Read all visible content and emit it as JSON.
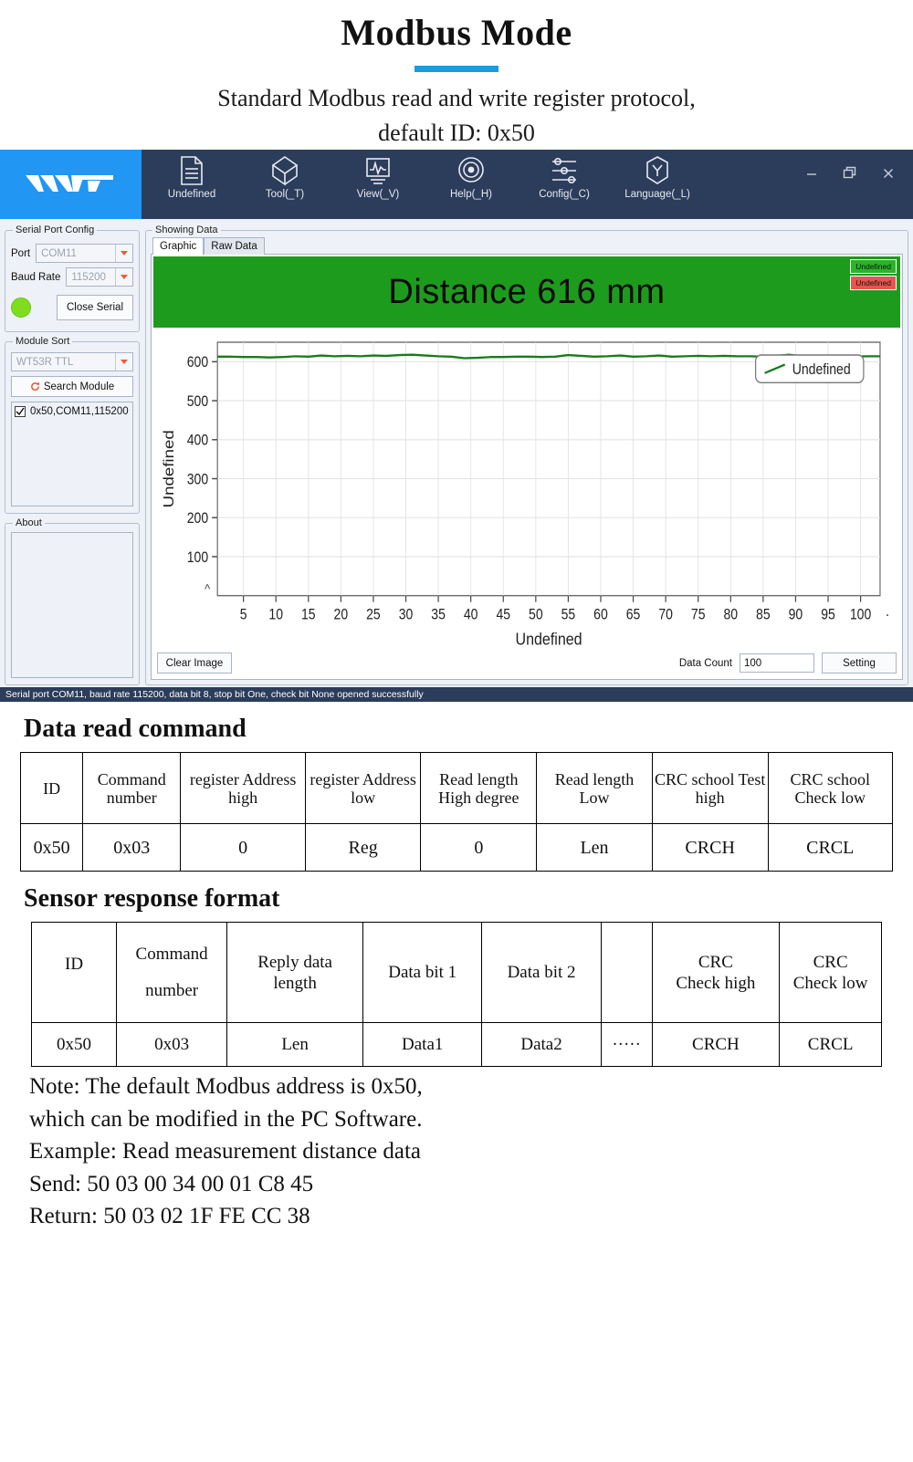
{
  "hero": {
    "title": "Modbus Mode",
    "rule_color": "#1e9ae0",
    "subtitle_line1": "Standard Modbus read and write register protocol,",
    "subtitle_line2": "default ID: 0x50"
  },
  "app": {
    "brand": "WIT",
    "titlebar_color": "#2b3d5b",
    "brand_color": "#2196f3",
    "menu": [
      {
        "label": "Undefined",
        "icon": "document-icon"
      },
      {
        "label": "Tool(_T)",
        "icon": "cube-icon"
      },
      {
        "label": "View(_V)",
        "icon": "waveform-icon"
      },
      {
        "label": "Help(_H)",
        "icon": "target-icon"
      },
      {
        "label": "Config(_C)",
        "icon": "sliders-icon"
      },
      {
        "label": "Language(_L)",
        "icon": "hexagon-y-icon"
      }
    ],
    "window_controls": {
      "minimize": "minimize-icon",
      "restore": "restore-icon",
      "close": "close-icon"
    },
    "sidebar": {
      "serial_group": {
        "legend": "Serial Port Config",
        "port_label": "Port",
        "port_value": "COM11",
        "baud_label": "Baud Rate",
        "baud_value": "115200",
        "led_color": "#7ede1e",
        "close_button": "Close Serial"
      },
      "module_group": {
        "legend": "Module Sort",
        "module_value": "WT53R TTL",
        "search_button": "Search Module",
        "list_items": [
          {
            "label": "0x50,COM11,115200",
            "checked": true
          }
        ]
      },
      "about_group": {
        "legend": "About"
      }
    },
    "showing_data": {
      "legend": "Showing Data",
      "tabs": [
        {
          "label": "Graphic",
          "active": true
        },
        {
          "label": "Raw Data",
          "active": false
        }
      ],
      "banner": {
        "text": "Distance  616 mm",
        "background": "#1d9b1d",
        "badges": [
          {
            "label": "Undefined",
            "color": "#2bb32b"
          },
          {
            "label": "Undefined",
            "color": "#e8554f"
          }
        ]
      },
      "bottom": {
        "clear_button": "Clear Image",
        "data_count_label": "Data Count",
        "data_count_value": "100",
        "setting_button": "Setting"
      }
    },
    "statusbar": "Serial port COM11, baud rate 115200, data bit 8, stop bit One, check bit None opened successfully"
  },
  "chart_data": {
    "type": "line",
    "title": "",
    "xlabel": "Undefined",
    "ylabel": "Undefined",
    "legend": [
      "Undefined"
    ],
    "legend_position": "top-right",
    "grid": true,
    "line_color": "#1a7a1a",
    "xlim": [
      1,
      103
    ],
    "ylim": [
      0,
      650
    ],
    "xticks": [
      5,
      10,
      15,
      20,
      25,
      30,
      35,
      40,
      45,
      50,
      55,
      60,
      65,
      70,
      75,
      80,
      85,
      90,
      95,
      100
    ],
    "yticks": [
      100,
      200,
      300,
      400,
      500,
      600
    ],
    "series": [
      {
        "name": "Undefined",
        "x": [
          1,
          3,
          5,
          7,
          9,
          11,
          13,
          15,
          17,
          19,
          21,
          23,
          25,
          27,
          29,
          31,
          33,
          35,
          37,
          39,
          41,
          43,
          45,
          47,
          49,
          51,
          53,
          55,
          57,
          59,
          61,
          63,
          65,
          67,
          69,
          71,
          73,
          75,
          77,
          79,
          81,
          83,
          85,
          87,
          89,
          91,
          93,
          95,
          97,
          99,
          101,
          103
        ],
        "values": [
          613,
          613,
          612,
          612,
          611,
          612,
          614,
          613,
          616,
          614,
          615,
          614,
          616,
          615,
          617,
          618,
          616,
          614,
          613,
          609,
          610,
          612,
          612,
          613,
          613,
          612,
          613,
          617,
          615,
          613,
          614,
          616,
          613,
          614,
          616,
          613,
          614,
          615,
          614,
          615,
          614,
          614,
          613,
          615,
          618,
          614,
          613,
          614,
          614,
          613,
          614,
          614
        ]
      }
    ]
  },
  "read_command": {
    "section_title": "Data read command",
    "headers": [
      "ID",
      "Command number",
      "register Address high",
      "register Address low",
      "Read length High degree",
      "Read length Low",
      "CRC school Test high",
      "CRC school Check low"
    ],
    "rows": [
      [
        "0x50",
        "0x03",
        "0",
        "Reg",
        "0",
        "Len",
        "CRCH",
        "CRCL"
      ]
    ]
  },
  "response_format": {
    "section_title": "Sensor response format",
    "headers": [
      {
        "top": "ID",
        "bottom": ""
      },
      {
        "top": "Command",
        "bottom": "number"
      },
      {
        "top": "Reply data",
        "bottom": "length"
      },
      {
        "top": "Data bit 1",
        "bottom": ""
      },
      {
        "top": "Data bit 2",
        "bottom": ""
      },
      {
        "top": "",
        "bottom": ""
      },
      {
        "top": "CRC",
        "bottom": "Check high"
      },
      {
        "top": "CRC",
        "bottom": "Check low"
      }
    ],
    "rows": [
      [
        "0x50",
        "0x03",
        "Len",
        "Data1",
        "Data2",
        "·····",
        "CRCH",
        "CRCL"
      ]
    ]
  },
  "notes": {
    "line1": "Note: The default Modbus address is 0x50,",
    "line2": "which can be modified in the PC Software.",
    "line3": "Example: Read measurement distance data",
    "line4": "Send: 50 03 00 34 00 01 C8 45",
    "line5": "Return: 50 03 02 1F FE CC 38"
  }
}
